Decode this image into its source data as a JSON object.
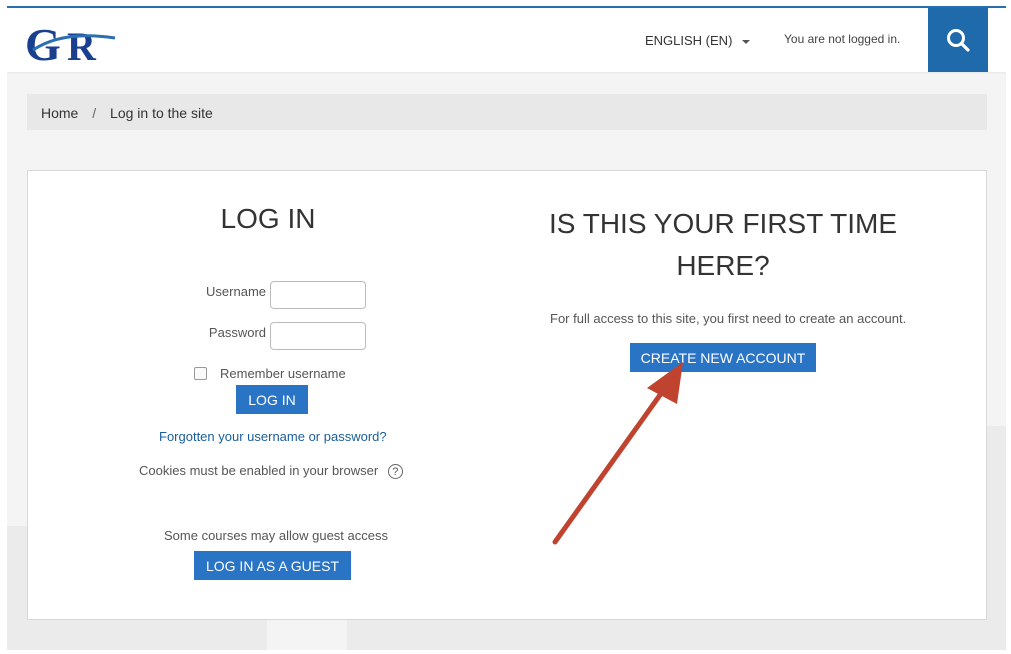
{
  "header": {
    "logo_text": "GR",
    "language": "ENGLISH (EN)",
    "login_status": "You are not logged in.",
    "icons": {
      "search": "search-icon",
      "language_caret": "caret-down-icon"
    },
    "colors": {
      "accent": "#1f6aab",
      "button": "#2a74c5",
      "annotation_arrow": "#c0432f"
    }
  },
  "breadcrumb": {
    "home": "Home",
    "separator": "/",
    "current": "Log in to the site"
  },
  "login": {
    "heading": "LOG IN",
    "username_label": "Username",
    "username_value": "",
    "password_label": "Password",
    "password_value": "",
    "remember_label": "Remember username",
    "remember_checked": false,
    "login_button": "LOG IN",
    "forgot_link": "Forgotten your username or password?",
    "cookies_notice": "Cookies must be enabled in your browser",
    "help_icon": "question-circle-icon",
    "guest_notice": "Some courses may allow guest access",
    "guest_button": "LOG IN AS A GUEST"
  },
  "signup": {
    "heading_line1": "IS THIS YOUR FIRST TIME",
    "heading_line2": "HERE?",
    "description": "For full access to this site, you first need to create an account.",
    "create_button": "CREATE NEW ACCOUNT"
  }
}
